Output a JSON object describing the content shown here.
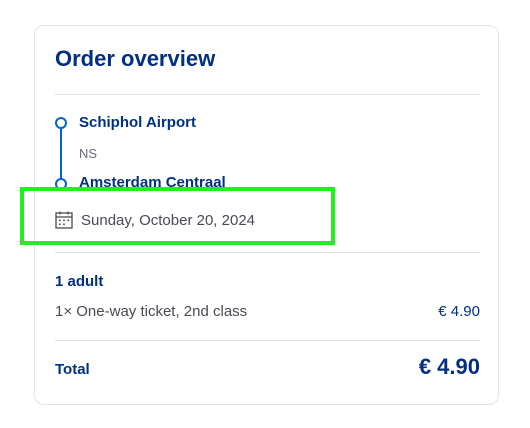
{
  "order": {
    "title": "Order overview",
    "route": {
      "from": "Schiphol Airport",
      "carrier": "NS",
      "to": "Amsterdam Centraal"
    },
    "date": "Sunday, October 20, 2024",
    "passengers_label": "1 adult",
    "ticket": {
      "description": "1× One-way ticket, 2nd class",
      "price": "€ 4.90"
    },
    "total": {
      "label": "Total",
      "price": "€ 4.90"
    }
  },
  "icons": {
    "date": "calendar-icon"
  },
  "colors": {
    "brand": "#003082",
    "route_line": "#0063d3",
    "highlight": "#22ee22"
  }
}
